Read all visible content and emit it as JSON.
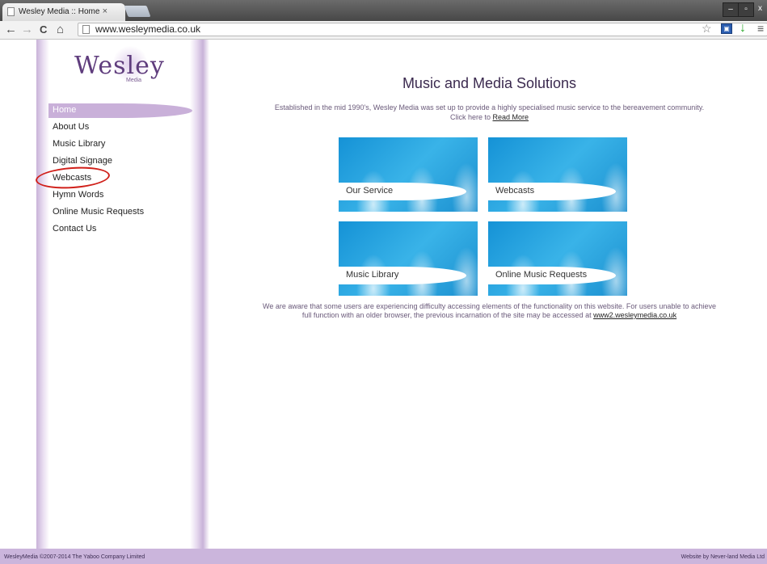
{
  "browser": {
    "tab_title": "Wesley Media :: Home",
    "tab_close": "×",
    "url": "www.wesleymedia.co.uk",
    "back": "←",
    "forward": "→",
    "reload": "C",
    "home": "⌂",
    "star": "☆",
    "menu": "≡",
    "win_min": "–",
    "win_max": "▫",
    "win_close": "x"
  },
  "logo": {
    "text": "Wesley",
    "sub": "Media"
  },
  "nav": [
    {
      "label": "Home",
      "active": true
    },
    {
      "label": "About Us"
    },
    {
      "label": "Music Library"
    },
    {
      "label": "Digital Signage"
    },
    {
      "label": "Webcasts"
    },
    {
      "label": "Hymn Words"
    },
    {
      "label": "Online Music Requests"
    },
    {
      "label": "Contact Us"
    }
  ],
  "main": {
    "title": "Music and Media Solutions",
    "intro_line1": "Established in the mid 1990's, Wesley Media was set up to provide a highly specialised music service to the bereavement community.",
    "intro_line2_prefix": "Click here to ",
    "read_more": "Read More",
    "tiles": [
      "Our Service",
      "Webcasts",
      "Music Library",
      "Online Music Requests"
    ],
    "footnote_line1": "We are aware that some users are experiencing difficulty accessing elements of the functionality on this website. For users unable to achieve",
    "footnote_line2_prefix": "full function with an older browser, the previous incarnation of the site may be accessed at ",
    "footnote_link": "www2.wesleymedia.co.uk"
  },
  "footer": {
    "left": "WesleyMedia ©2007-2014 The Yaboo Company Limited",
    "right": "Website by Never-land Media Ltd"
  },
  "colors": {
    "accent": "#c9b0d9",
    "annotation": "#d0201a",
    "tile": "#1b9ad8"
  }
}
